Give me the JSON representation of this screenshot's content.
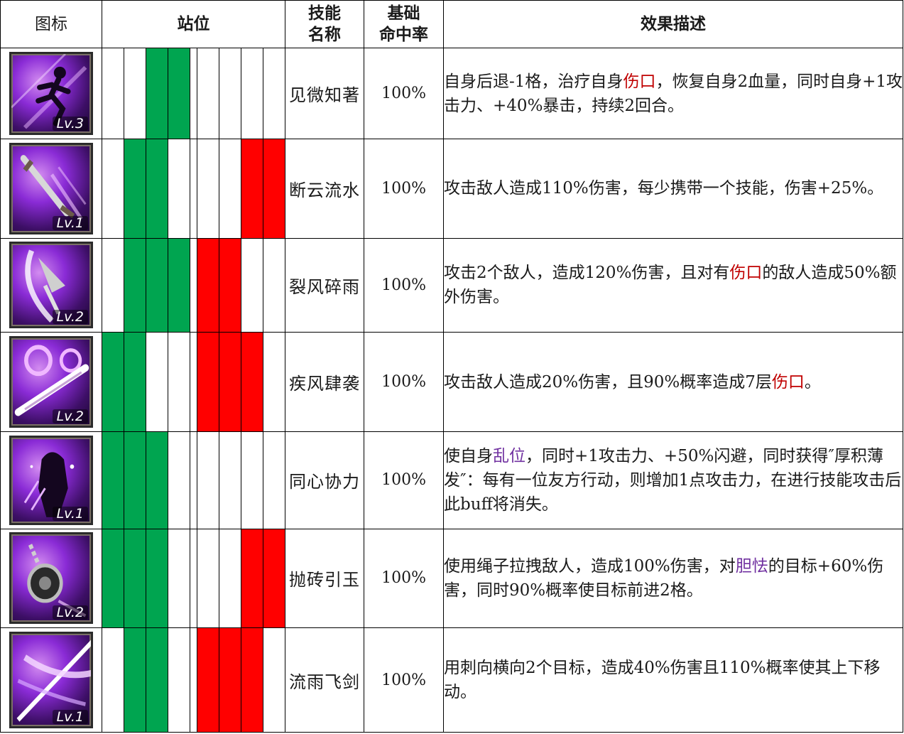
{
  "header": {
    "icon": "图标",
    "position": "站位",
    "skill_name": "技能名称",
    "skill_name_l1": "技能",
    "skill_name_l2": "名称",
    "hit_rate_l1": "基础",
    "hit_rate_l2": "命中率",
    "effect": "效果描述"
  },
  "colors": {
    "ally": "#00a550",
    "enemy": "#ff0000",
    "keyword_red": "#c00000",
    "keyword_purple": "#7030a0"
  },
  "skills": [
    {
      "icon": "running-figure-icon",
      "level": "Lv.3",
      "ally_positions": [
        false,
        false,
        true,
        true
      ],
      "enemy_positions": [
        false,
        false,
        false,
        false
      ],
      "name": "见微知著",
      "hit_rate": "100%",
      "desc_parts": [
        "自身后退-1格，治疗自身",
        "伤口",
        "，恢复自身2血量，同时自身+1攻击力、+40%暴击，持续2回合。"
      ]
    },
    {
      "icon": "dagger-icon",
      "level": "Lv.1",
      "ally_positions": [
        false,
        true,
        true,
        false
      ],
      "enemy_positions": [
        false,
        false,
        true,
        true
      ],
      "name": "断云流水",
      "hit_rate": "100%",
      "desc_parts": [
        "攻击敌人造成110%伤害，每少携带一个技能，伤害+25%。"
      ]
    },
    {
      "icon": "blade-slash-icon",
      "level": "Lv.2",
      "ally_positions": [
        false,
        true,
        true,
        true
      ],
      "enemy_positions": [
        true,
        true,
        false,
        false
      ],
      "name": "裂风碎雨",
      "hit_rate": "100%",
      "desc_parts": [
        "攻击2个敌人，造成120%伤害，且对有",
        "伤口",
        "的敌人造成50%额外伤害。"
      ]
    },
    {
      "icon": "sword-swirl-icon",
      "level": "Lv.2",
      "ally_positions": [
        true,
        true,
        false,
        false
      ],
      "enemy_positions": [
        true,
        true,
        true,
        false
      ],
      "name": "疾风肆袭",
      "hit_rate": "100%",
      "desc_parts": [
        "攻击敌人造成20%伤害，且90%概率造成7层",
        "伤口",
        "。"
      ]
    },
    {
      "icon": "hooded-figure-icon",
      "level": "Lv.1",
      "ally_positions": [
        true,
        true,
        true,
        false
      ],
      "enemy_positions": [
        false,
        false,
        false,
        false
      ],
      "name": "同心协力",
      "hit_rate": "100%",
      "desc_parts": [
        "使自身",
        "乱位",
        "，同时+1攻击力、+50%闪避，同时获得″厚积薄发″：每有一位友方行动，则增加1点攻击力，在进行技能攻击后此buff将消失。"
      ]
    },
    {
      "icon": "chain-hook-icon",
      "level": "Lv.2",
      "ally_positions": [
        true,
        true,
        true,
        false
      ],
      "enemy_positions": [
        false,
        false,
        true,
        true
      ],
      "name": "抛砖引玉",
      "hit_rate": "100%",
      "desc_parts": [
        "使用绳子拉拽敌人，造成100%伤害，对",
        "胆怯",
        "的目标+60%伤害，同时90%概率使目标前进2格。"
      ]
    },
    {
      "icon": "crossed-blades-icon",
      "level": "Lv.1",
      "ally_positions": [
        false,
        true,
        true,
        false
      ],
      "enemy_positions": [
        true,
        true,
        true,
        false
      ],
      "name": "流雨飞剑",
      "hit_rate": "100%",
      "desc_parts": [
        "用刺向横向2个目标，造成40%伤害且110%概率使其上下移动。"
      ]
    }
  ]
}
